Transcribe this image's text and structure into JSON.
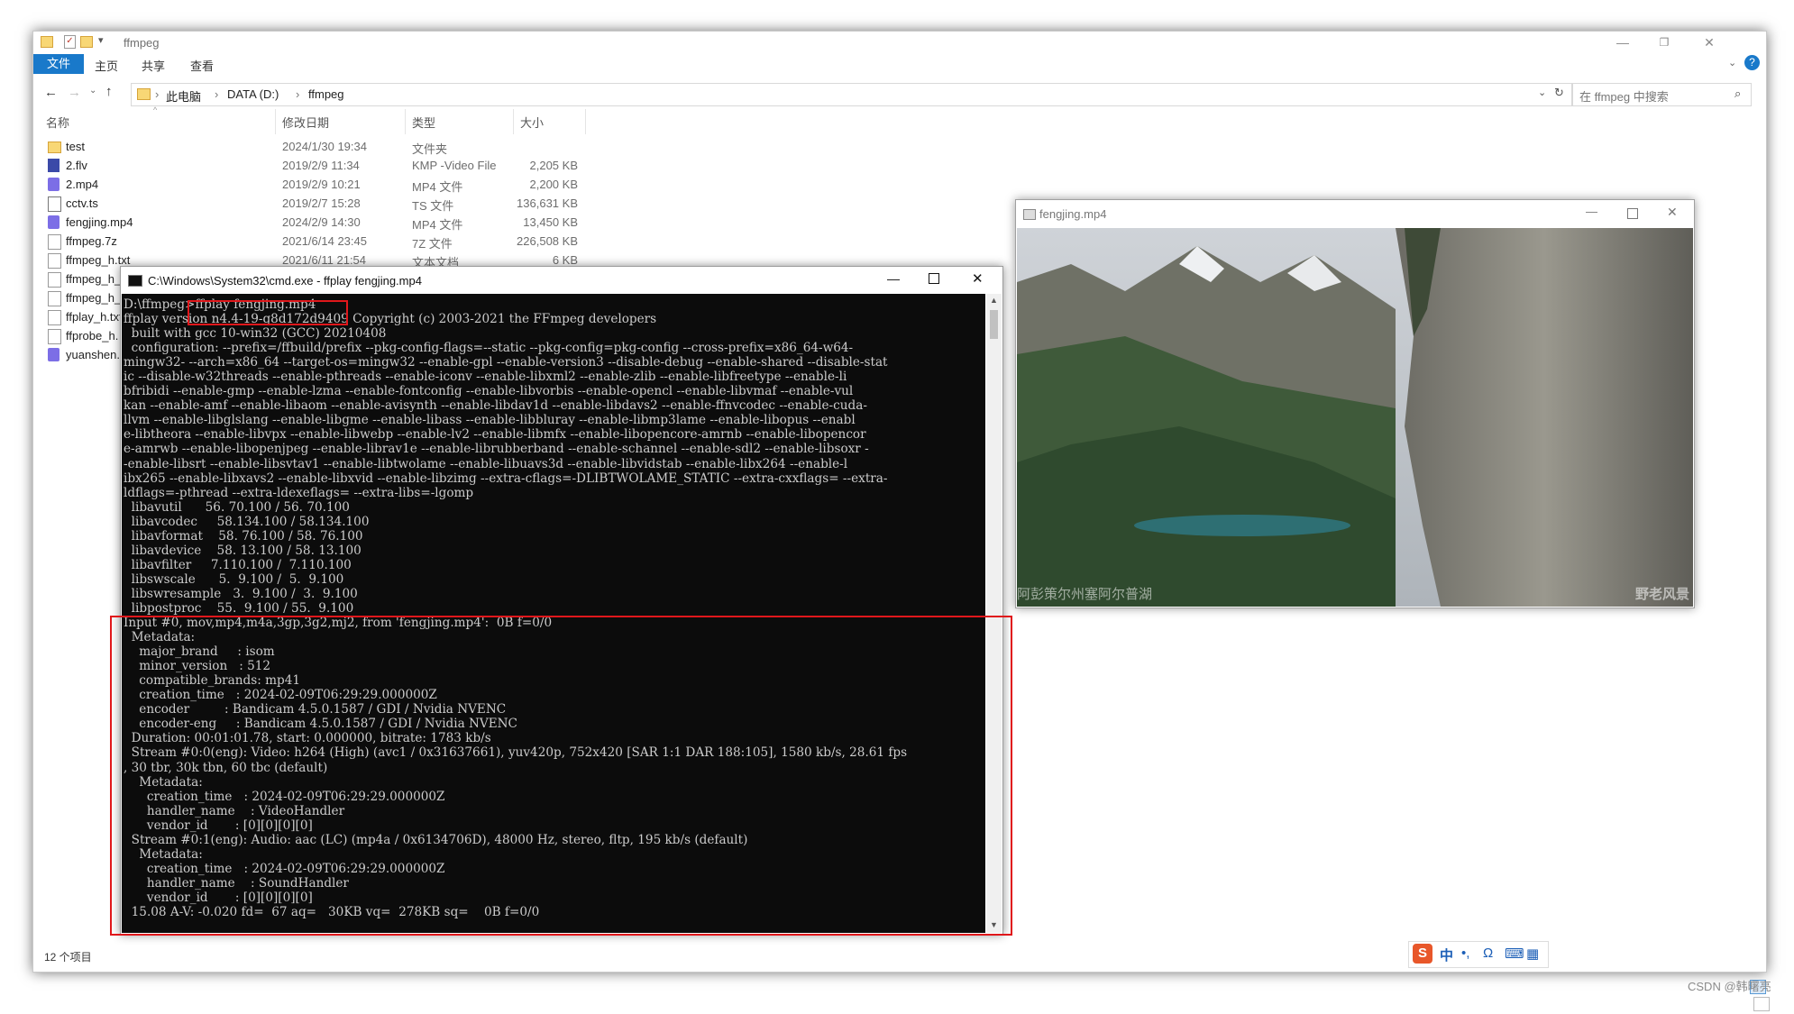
{
  "explorer": {
    "title": "ffmpeg",
    "ribbon": {
      "file": "文件",
      "home": "主页",
      "share": "共享",
      "view": "查看"
    },
    "breadcrumb": [
      "此电脑",
      "DATA (D:)",
      "ffmpeg"
    ],
    "search_placeholder": "在 ffmpeg 中搜索",
    "columns": {
      "name": "名称",
      "date": "修改日期",
      "type": "类型",
      "size": "大小"
    },
    "files": [
      {
        "name": "test",
        "date": "2024/1/30 19:34",
        "type": "文件夹",
        "size": ""
      },
      {
        "name": "2.flv",
        "date": "2019/2/9 11:34",
        "type": "KMP -Video File",
        "size": "2,205 KB"
      },
      {
        "name": "2.mp4",
        "date": "2019/2/9 10:21",
        "type": "MP4 文件",
        "size": "2,200 KB"
      },
      {
        "name": "cctv.ts",
        "date": "2019/2/7 15:28",
        "type": "TS 文件",
        "size": "136,631 KB"
      },
      {
        "name": "fengjing.mp4",
        "date": "2024/2/9 14:30",
        "type": "MP4 文件",
        "size": "13,450 KB"
      },
      {
        "name": "ffmpeg.7z",
        "date": "2021/6/14 23:45",
        "type": "7Z 文件",
        "size": "226,508 KB"
      },
      {
        "name": "ffmpeg_h.txt",
        "date": "2021/6/11 21:54",
        "type": "文本文档",
        "size": "6 KB"
      },
      {
        "name": "ffmpeg_h_",
        "date": "",
        "type": "",
        "size": ""
      },
      {
        "name": "ffmpeg_h_",
        "date": "",
        "type": "",
        "size": ""
      },
      {
        "name": "ffplay_h.txt",
        "date": "",
        "type": "",
        "size": ""
      },
      {
        "name": "ffprobe_h.",
        "date": "",
        "type": "",
        "size": ""
      },
      {
        "name": "yuanshen.r",
        "date": "",
        "type": "",
        "size": ""
      }
    ],
    "status": "12 个项目"
  },
  "cmd": {
    "title": "C:\\Windows\\System32\\cmd.exe - ffplay  fengjing.mp4",
    "lines": [
      "D:\\ffmpeg>ffplay fengjing.mp4",
      "ffplay version n4.4-19-g8d172d9409 Copyright (c) 2003-2021 the FFmpeg developers",
      "  built with gcc 10-win32 (GCC) 20210408",
      "  configuration: --prefix=/ffbuild/prefix --pkg-config-flags=--static --pkg-config=pkg-config --cross-prefix=x86_64-w64-",
      "mingw32- --arch=x86_64 --target-os=mingw32 --enable-gpl --enable-version3 --disable-debug --enable-shared --disable-stat",
      "ic --disable-w32threads --enable-pthreads --enable-iconv --enable-libxml2 --enable-zlib --enable-libfreetype --enable-li",
      "bfribidi --enable-gmp --enable-lzma --enable-fontconfig --enable-libvorbis --enable-opencl --enable-libvmaf --enable-vul",
      "kan --enable-amf --enable-libaom --enable-avisynth --enable-libdav1d --enable-libdavs2 --enable-ffnvcodec --enable-cuda-",
      "llvm --enable-libglslang --enable-libgme --enable-libass --enable-libbluray --enable-libmp3lame --enable-libopus --enabl",
      "e-libtheora --enable-libvpx --enable-libwebp --enable-lv2 --enable-libmfx --enable-libopencore-amrnb --enable-libopencor",
      "e-amrwb --enable-libopenjpeg --enable-librav1e --enable-librubberband --enable-schannel --enable-sdl2 --enable-libsoxr -",
      "-enable-libsrt --enable-libsvtav1 --enable-libtwolame --enable-libuavs3d --enable-libvidstab --enable-libx264 --enable-l",
      "ibx265 --enable-libxavs2 --enable-libxvid --enable-libzimg --extra-cflags=-DLIBTWOLAME_STATIC --extra-cxxflags= --extra-",
      "ldflags=-pthread --extra-ldexeflags= --extra-libs=-lgomp",
      "  libavutil      56. 70.100 / 56. 70.100",
      "  libavcodec     58.134.100 / 58.134.100",
      "  libavformat    58. 76.100 / 58. 76.100",
      "  libavdevice    58. 13.100 / 58. 13.100",
      "  libavfilter     7.110.100 /  7.110.100",
      "  libswscale      5.  9.100 /  5.  9.100",
      "  libswresample   3.  9.100 /  3.  9.100",
      "  libpostproc    55.  9.100 / 55.  9.100",
      "Input #0, mov,mp4,m4a,3gp,3g2,mj2, from 'fengjing.mp4':  0B f=0/0",
      "  Metadata:",
      "    major_brand     : isom",
      "    minor_version   : 512",
      "    compatible_brands: mp41",
      "    creation_time   : 2024-02-09T06:29:29.000000Z",
      "    encoder         : Bandicam 4.5.0.1587 / GDI / Nvidia NVENC",
      "    encoder-eng     : Bandicam 4.5.0.1587 / GDI / Nvidia NVENC",
      "  Duration: 00:01:01.78, start: 0.000000, bitrate: 1783 kb/s",
      "  Stream #0:0(eng): Video: h264 (High) (avc1 / 0x31637661), yuv420p, 752x420 [SAR 1:1 DAR 188:105], 1580 kb/s, 28.61 fps",
      ", 30 tbr, 30k tbn, 60 tbc (default)",
      "    Metadata:",
      "      creation_time   : 2024-02-09T06:29:29.000000Z",
      "      handler_name    : VideoHandler",
      "      vendor_id       : [0][0][0][0]",
      "  Stream #0:1(eng): Audio: aac (LC) (mp4a / 0x6134706D), 48000 Hz, stereo, fltp, 195 kb/s (default)",
      "    Metadata:",
      "      creation_time   : 2024-02-09T06:29:29.000000Z",
      "      handler_name    : SoundHandler",
      "      vendor_id       : [0][0][0][0]",
      "  15.08 A-V: -0.020 fd=  67 aq=   30KB vq=  278KB sq=    0B f=0/0"
    ]
  },
  "player": {
    "title": "fengjing.mp4",
    "caption": "阿彭策尔州塞阿尔普湖",
    "watermark": "野老风景"
  },
  "ime": {
    "label": "中"
  },
  "credit": "CSDN @韩曙亮"
}
